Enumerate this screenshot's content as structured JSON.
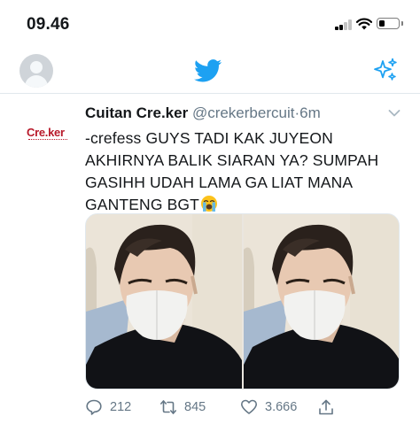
{
  "status_bar": {
    "time": "09.46"
  },
  "nav_bar": {
    "icons": [
      "profile-avatar",
      "twitter-bird-icon",
      "sparkle-icon"
    ],
    "accent_color": "#1da1f2"
  },
  "tweet": {
    "avatar_brand": "Cre.ker",
    "display_name": "Cuitan Cre.ker",
    "handle": "@crekerbercuit",
    "separator": "·",
    "time": "6m",
    "text_lines": [
      "-crefess GUYS TADI KAK JUYEON",
      "AKHIRNYA BALIK SIARAN YA? SUMPAH",
      "GASIHH UDAH LAMA GA LIAT MANA",
      "GANTENG BGT"
    ],
    "emoji": "loudly-crying-face",
    "media_count": 2,
    "actions": {
      "replies": "212",
      "retweets": "845",
      "likes": "3.666"
    }
  }
}
